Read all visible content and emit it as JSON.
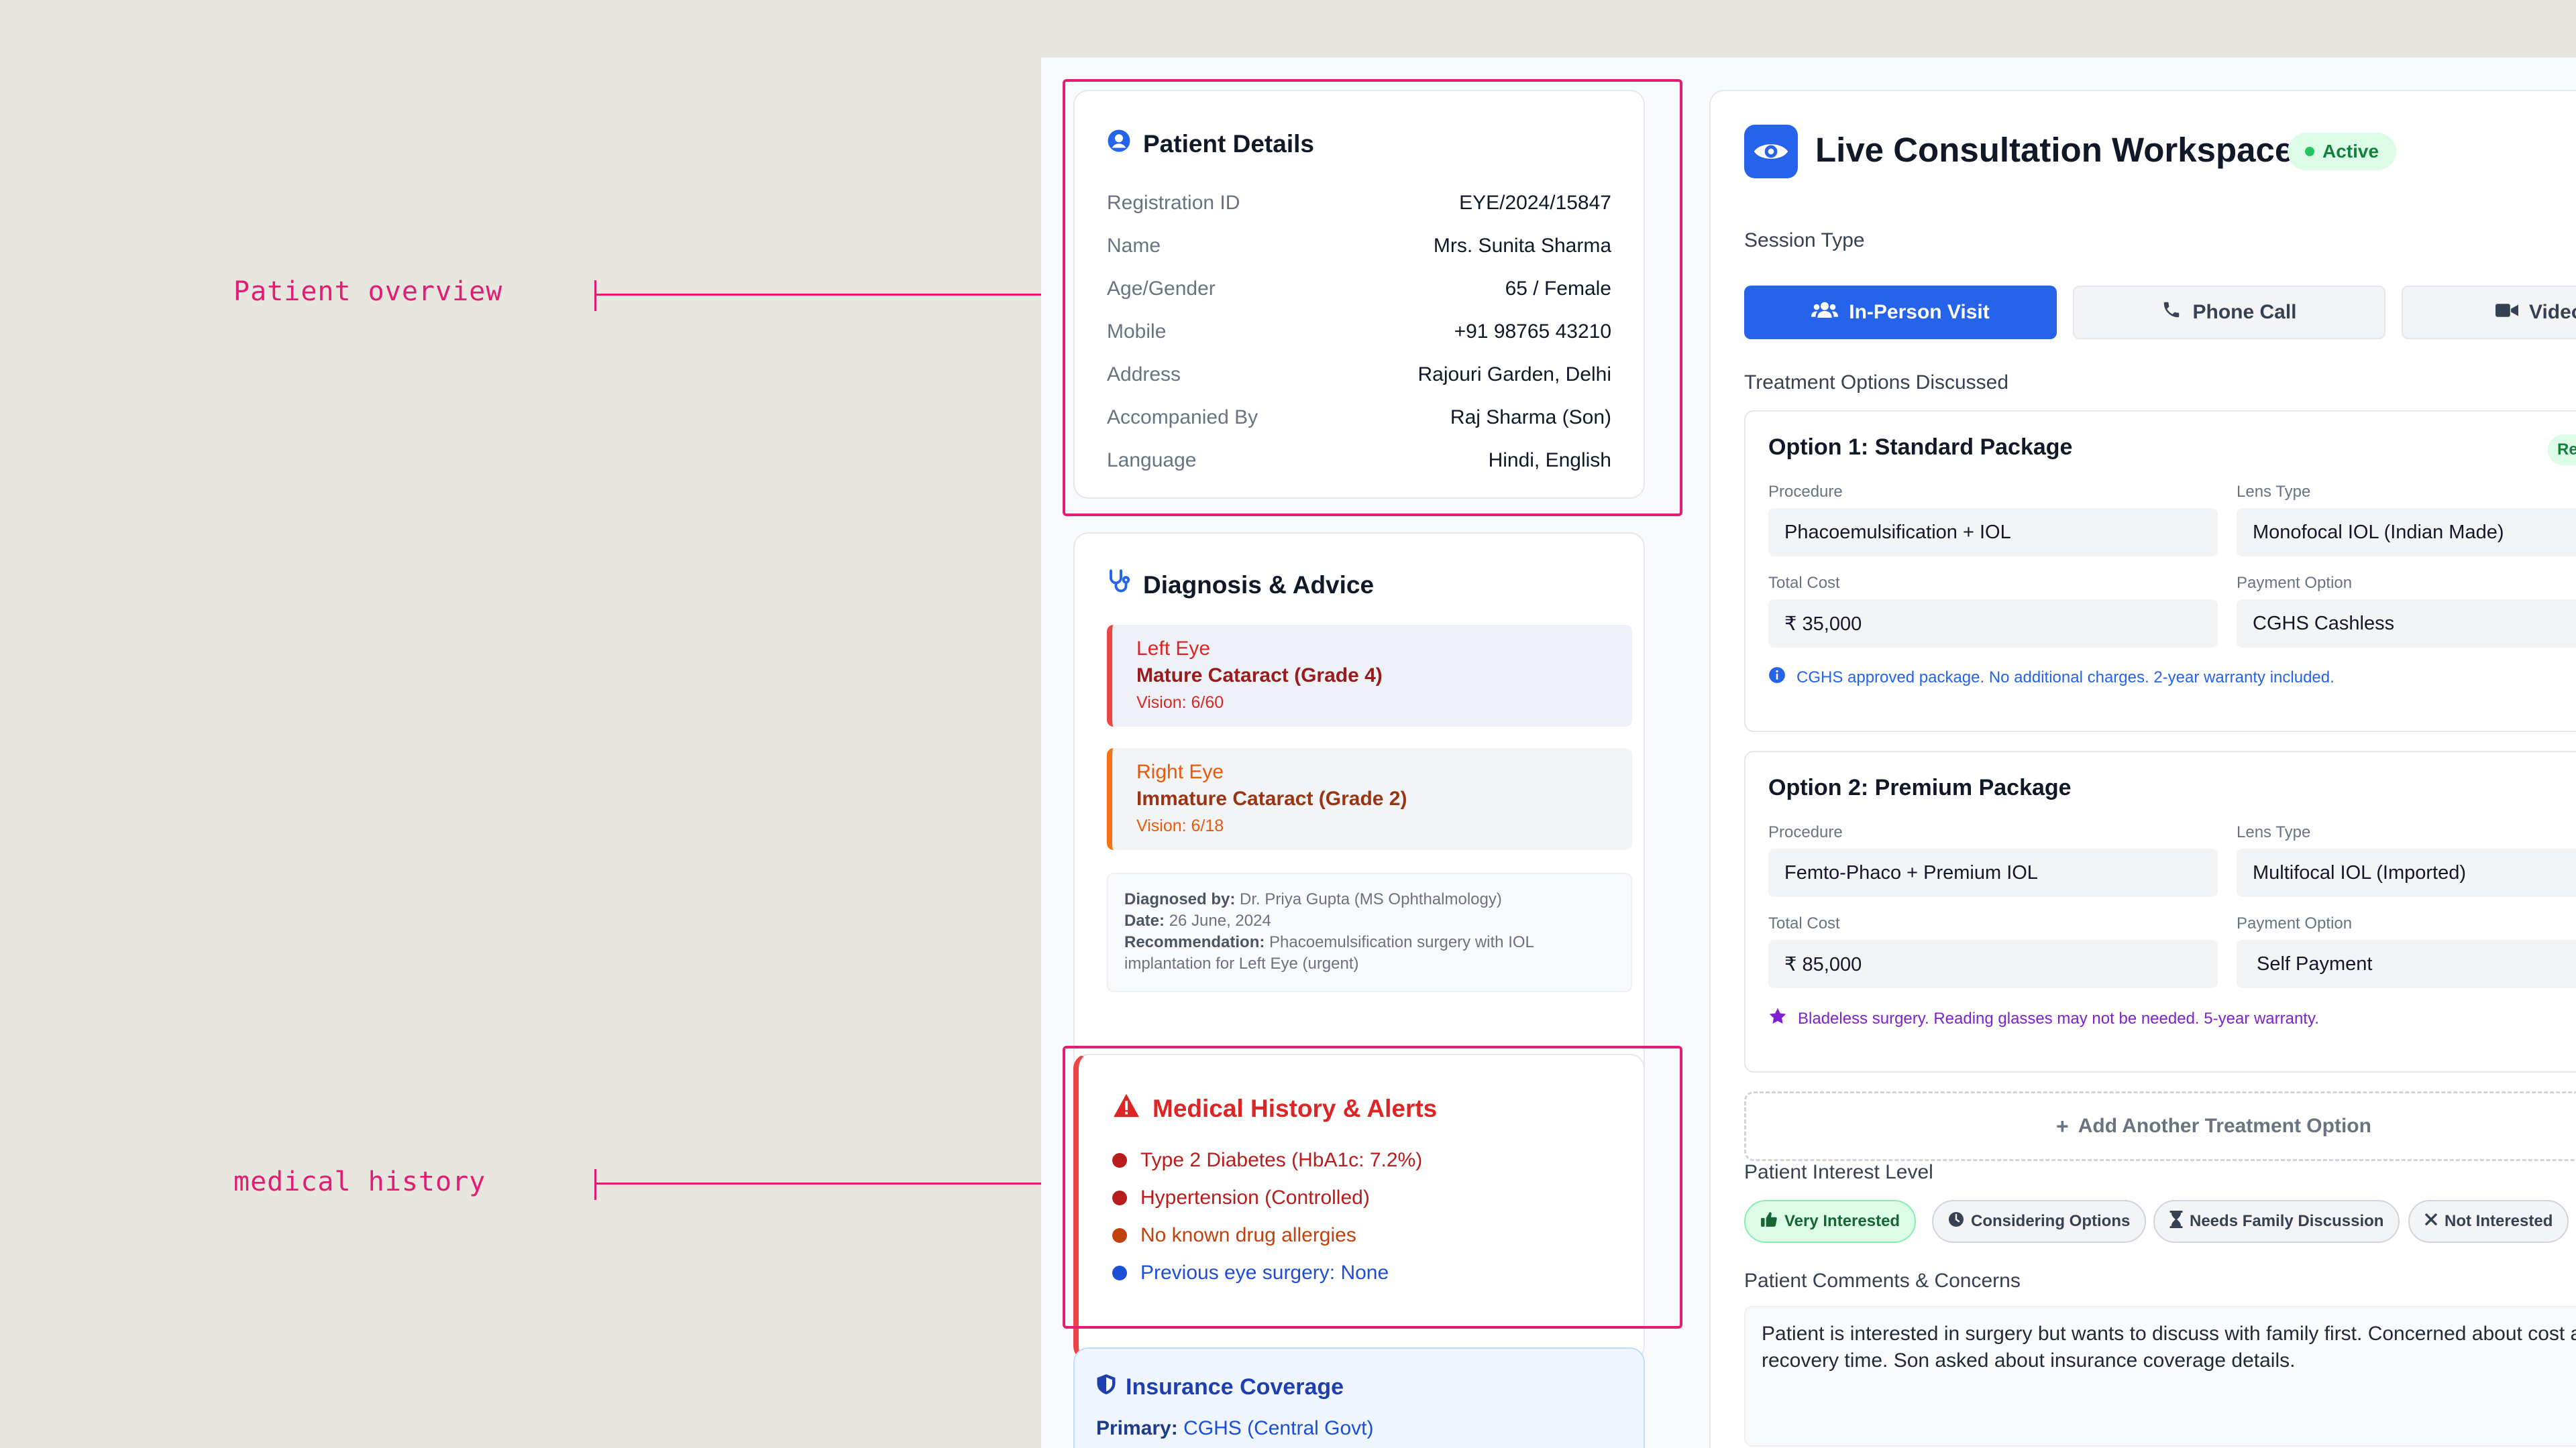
{
  "annotations": {
    "patient_overview": "Patient overview",
    "medical_history": "medical history"
  },
  "patient": {
    "title": "Patient Details",
    "rows": [
      {
        "label": "Registration ID",
        "value": "EYE/2024/15847"
      },
      {
        "label": "Name",
        "value": "Mrs. Sunita Sharma"
      },
      {
        "label": "Age/Gender",
        "value": "65 / Female"
      },
      {
        "label": "Mobile",
        "value": "+91 98765 43210"
      },
      {
        "label": "Address",
        "value": "Rajouri Garden, Delhi"
      },
      {
        "label": "Accompanied By",
        "value": "Raj Sharma (Son)"
      },
      {
        "label": "Language",
        "value": "Hindi, English"
      }
    ]
  },
  "diagnosis": {
    "title": "Diagnosis & Advice",
    "left_eye": {
      "name": "Left Eye",
      "dx": "Mature Cataract (Grade 4)",
      "vision": "Vision: 6/60"
    },
    "right_eye": {
      "name": "Right Eye",
      "dx": "Immature Cataract (Grade 2)",
      "vision": "Vision: 6/18"
    },
    "diagnosed_by_label": "Diagnosed by:",
    "diagnosed_by": "Dr. Priya Gupta (MS Ophthalmology)",
    "date_label": "Date:",
    "date": "26 June, 2024",
    "recommendation_label": "Recommendation:",
    "recommendation": "Phacoemulsification surgery with IOL implantation for Left Eye (urgent)"
  },
  "history": {
    "title": "Medical History & Alerts",
    "items": [
      {
        "text": "Type 2 Diabetes (HbA1c: 7.2%)",
        "color": "#b91c1c"
      },
      {
        "text": "Hypertension (Controlled)",
        "color": "#b91c1c"
      },
      {
        "text": "No known drug allergies",
        "color": "#c2410c"
      },
      {
        "text": "Previous eye surgery: None",
        "color": "#1d4ed8"
      }
    ]
  },
  "insurance": {
    "title": "Insurance Coverage",
    "primary_label": "Primary:",
    "primary": "CGHS (Central Govt)"
  },
  "workspace": {
    "title": "Live Consultation Workspace",
    "status": "Active",
    "session_type_label": "Session Type",
    "session_types": [
      "In-Person Visit",
      "Phone Call",
      "Video"
    ],
    "treatment_label": "Treatment Options Discussed",
    "option1": {
      "title": "Option 1: Standard Package",
      "badge": "Rec",
      "procedure_label": "Procedure",
      "procedure": "Phacoemulsification + IOL",
      "lens_label": "Lens Type",
      "lens": "Monofocal IOL (Indian Made)",
      "cost_label": "Total Cost",
      "cost": "₹ 35,000",
      "payment_label": "Payment Option",
      "payment": "CGHS Cashless",
      "note": "CGHS approved package. No additional charges. 2-year warranty included."
    },
    "option2": {
      "title": "Option 2: Premium Package",
      "procedure_label": "Procedure",
      "procedure": "Femto-Phaco + Premium IOL",
      "lens_label": "Lens Type",
      "lens": "Multifocal IOL (Imported)",
      "cost_label": "Total Cost",
      "cost": "₹ 85,000",
      "payment_label": "Payment Option",
      "payment": "Self Payment",
      "note": "Bladeless surgery. Reading glasses may not be needed. 5-year warranty."
    },
    "add_option": "Add Another Treatment Option",
    "interest_label": "Patient Interest Level",
    "interest_levels": [
      "Very Interested",
      "Considering Options",
      "Needs Family Discussion",
      "Not Interested"
    ],
    "comments_label": "Patient Comments & Concerns",
    "comments": "Patient is interested in surgery but wants to discuss with family first. Concerned about cost and recovery time. Son asked about insurance coverage details."
  },
  "colors": {
    "accent": "#2563eb",
    "annotation": "#e11d74",
    "alert": "#dc2626",
    "success": "#15803d"
  }
}
